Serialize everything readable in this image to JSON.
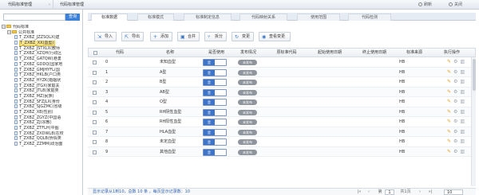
{
  "window_tabs": [
    {
      "label": "代码标准管理"
    },
    {
      "label": "代码标准管理"
    }
  ],
  "window_buttons": {
    "refresh": "刷新",
    "close": "关闭"
  },
  "search": {
    "placeholder": "",
    "button": "查询"
  },
  "tree": {
    "root": "代码标准",
    "group": "公共标准",
    "items": [
      "T_ZXBZ_JZZSQLX(建",
      "T_ZXBZ_XX(血型)",
      "T_ZXBZ_JSTXLX(教师",
      "T_ZXBZ_XZQH(行政区",
      "T_ZXBZ_GATQW(港澳",
      "T_ZXBZ_GDDQ(国家地",
      "T_ZXBZ_GMJHYFL(国",
      "T_ZXBZ_HKLB(户口类",
      "T_ZXBZ_HYZK(婚姻状",
      "T_ZXBZ_JTGX(家庭关",
      "T_ZXBZ_JTLB(家庭类",
      "T_ZXBZ_MZ(民族)",
      "T_ZXBZ_SFZJLX(身份",
      "T_ZXBZ_SJGZMC(省级",
      "T_ZXBZ_XB(性别)",
      "T_ZXBZ_ZGYZ(中国语",
      "T_ZXBZ_ZJ(宗教)",
      "T_ZXBZ_ZTFLH(中图",
      "T_ZXBZ_ZXDWLB(在校",
      "T_ZXBZ_QQLB(侨情类",
      "T_ZXBZ_ZZMM(政治面"
    ]
  },
  "subtabs": [
    "标准数据",
    "标准模式",
    "标准制定信息",
    "代码映射关系",
    "使用范围",
    "代码检测"
  ],
  "toolbar": {
    "import": "导入",
    "export": "导出",
    "add": "添加",
    "merge": "合并",
    "split": "拆分",
    "change": "变更",
    "view_change": "查看变更"
  },
  "columns": [
    "代码",
    "名称",
    "是否使用",
    "发布情况",
    "原标准代码",
    "起始使用日期",
    "终止使用日期",
    "标准来源",
    "执行操作"
  ],
  "rows": [
    {
      "code": "0",
      "name": "未知血型",
      "toggle": "是",
      "status": "未发布",
      "source": "HB"
    },
    {
      "code": "1",
      "name": "A型",
      "toggle": "是",
      "status": "未发布",
      "source": "HB"
    },
    {
      "code": "2",
      "name": "B型",
      "toggle": "是",
      "status": "未发布",
      "source": "HB"
    },
    {
      "code": "3",
      "name": "AB型",
      "toggle": "是",
      "status": "未发布",
      "source": "HB"
    },
    {
      "code": "4",
      "name": "O型",
      "toggle": "是",
      "status": "未发布",
      "source": "HB"
    },
    {
      "code": "5",
      "name": "RH阴性血型",
      "toggle": "是",
      "status": "未发布",
      "source": "HB"
    },
    {
      "code": "6",
      "name": "RH阳性血型",
      "toggle": "是",
      "status": "未发布",
      "source": "HB"
    },
    {
      "code": "7",
      "name": "HLA血型",
      "toggle": "是",
      "status": "未发布",
      "source": "HB"
    },
    {
      "code": "8",
      "name": "未定血型",
      "toggle": "是",
      "status": "未发布",
      "source": "HB"
    },
    {
      "code": "9",
      "name": "其他血型",
      "toggle": "是",
      "status": "未发布",
      "source": "HB"
    }
  ],
  "pager": {
    "info": "显示记录从1到10，总数 10 条 ，每页显示记录数：10",
    "first": "|«",
    "prev": "‹",
    "page_label_before": "第",
    "page": "1",
    "page_label_after": "共1页",
    "next": "›",
    "last": "»|",
    "page_size": "10"
  },
  "colors": {
    "accent": "#3d80d8",
    "badge": "#8f959d",
    "toggle": "#3d73c9"
  }
}
